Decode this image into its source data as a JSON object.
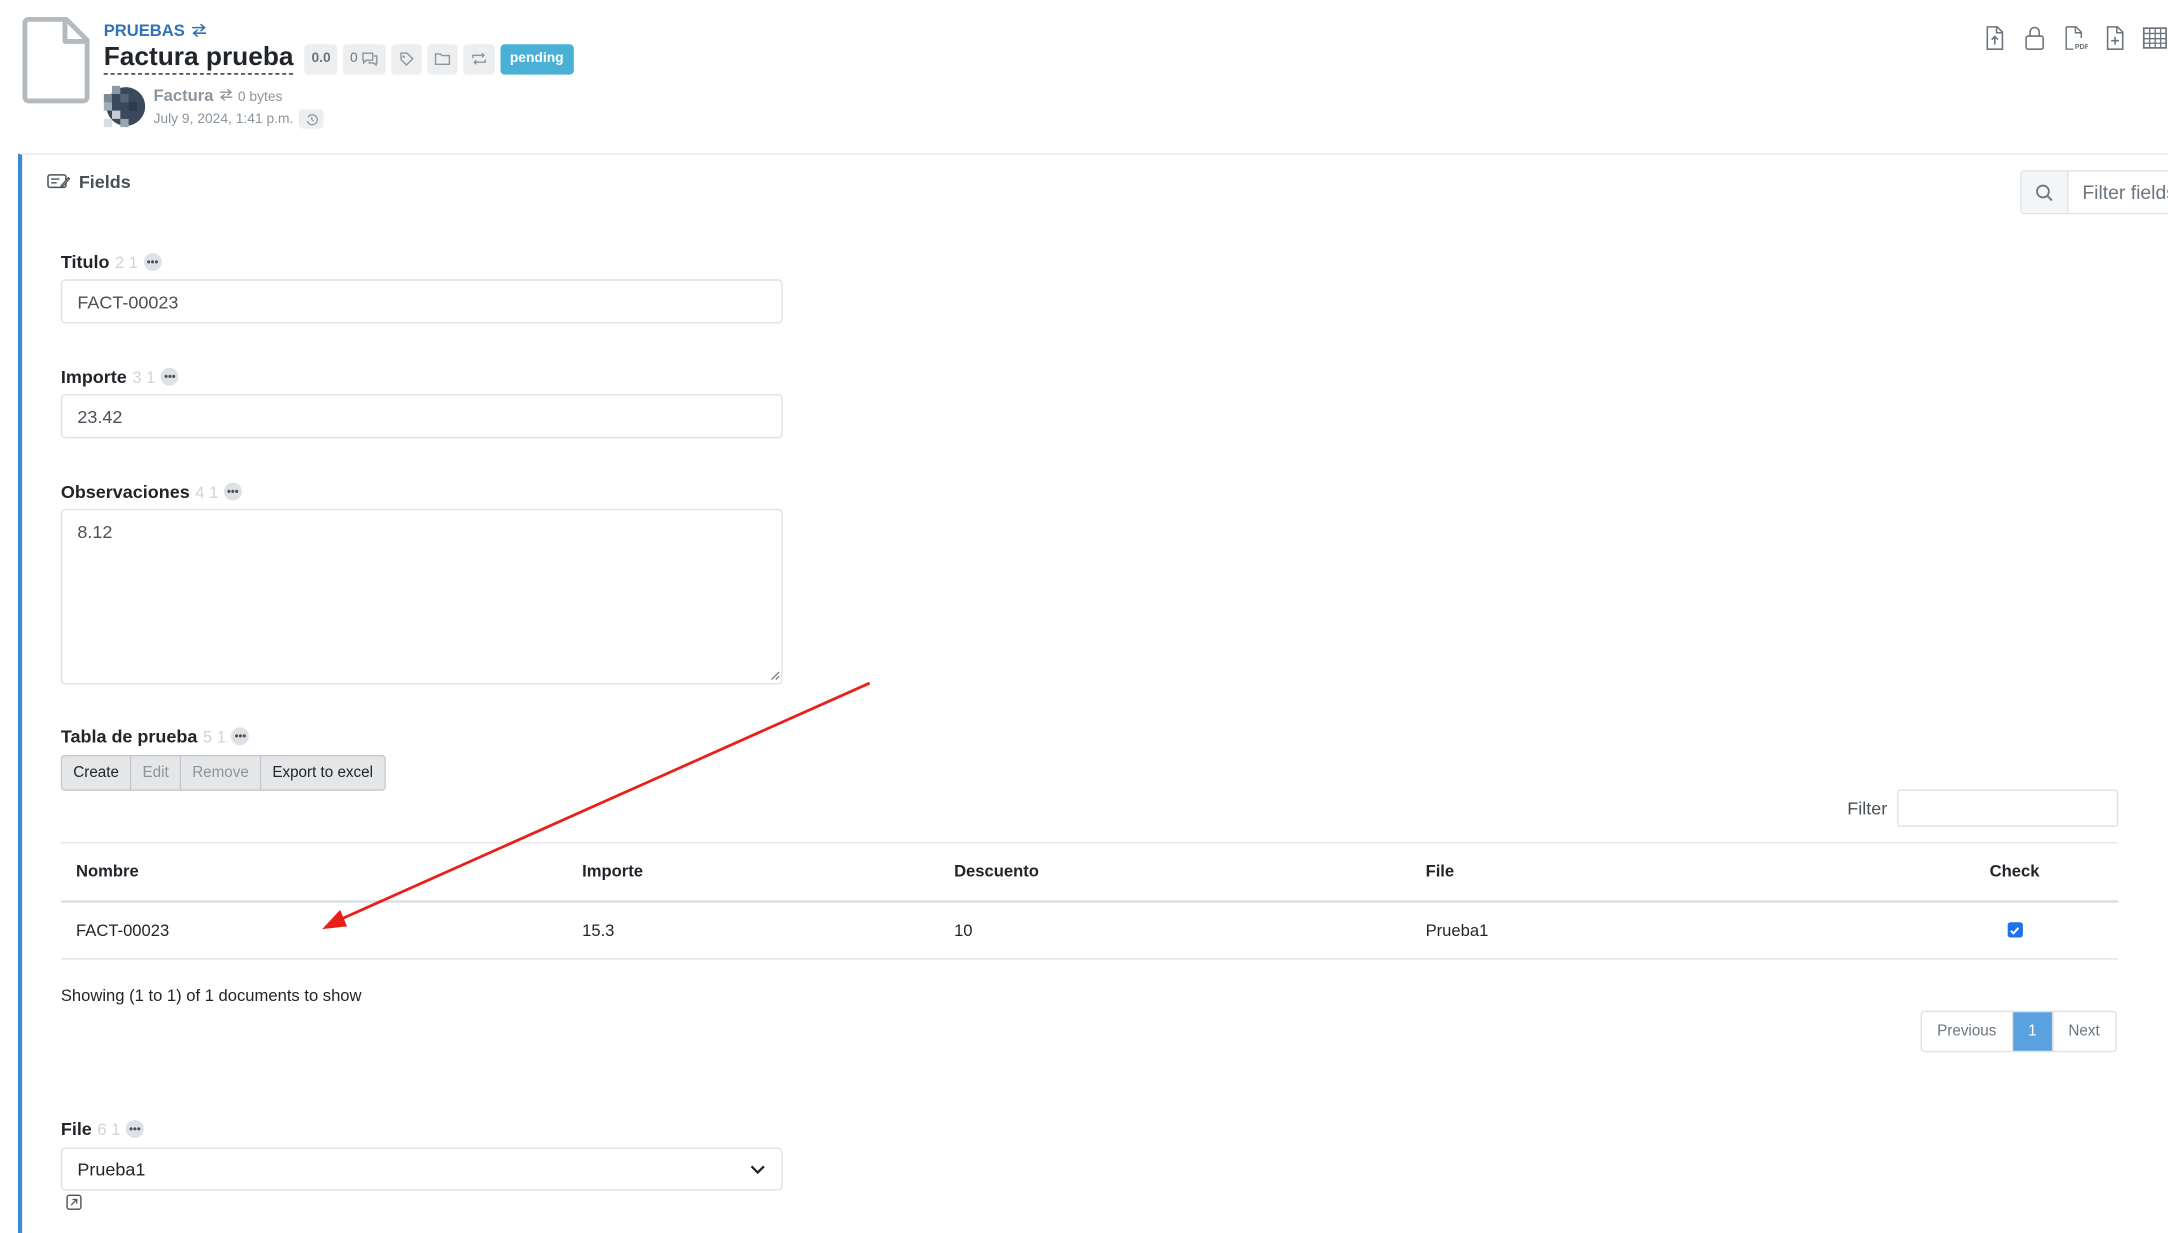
{
  "header": {
    "breadcrumb": "PRUEBAS",
    "title": "Factura prueba",
    "version_chip": "0.0",
    "comments_count": "0",
    "status_badge": "pending",
    "doctype": "Factura",
    "size": "0 bytes",
    "date": "July 9, 2024, 1:41 p.m."
  },
  "toolbar": {
    "icons": [
      "upload-file-icon",
      "lock-icon",
      "pdf-icon",
      "add-file-icon",
      "table-icon"
    ],
    "pdf_label": "PDF"
  },
  "panel": {
    "title": "Fields",
    "filter_placeholder": "Filter fields"
  },
  "fields": {
    "titulo": {
      "label": "Titulo",
      "nums": "2 1",
      "value": "FACT-00023"
    },
    "importe": {
      "label": "Importe",
      "nums": "3 1",
      "value": "23.42"
    },
    "observaciones": {
      "label": "Observaciones",
      "nums": "4 1",
      "value": "8.12"
    },
    "tabla": {
      "label": "Tabla de prueba",
      "nums": "5 1"
    },
    "file": {
      "label": "File",
      "nums": "6 1",
      "value": "Prueba1"
    }
  },
  "table": {
    "buttons": {
      "create": "Create",
      "edit": "Edit",
      "remove": "Remove",
      "export": "Export to excel"
    },
    "filter_label": "Filter",
    "columns": [
      "Nombre",
      "Importe",
      "Descuento",
      "File",
      "Check"
    ],
    "rows": [
      {
        "nombre": "FACT-00023",
        "importe": "15.3",
        "descuento": "10",
        "file": "Prueba1",
        "check": true
      }
    ],
    "showing": "Showing (1 to 1) of 1 documents to show",
    "pager": {
      "previous": "Previous",
      "page": "1",
      "next": "Next"
    }
  },
  "colors": {
    "accent": "#2f72b5",
    "pending": "#4ab0d6",
    "panel_border": "#3d87d4",
    "annotation": "#e8201a"
  }
}
